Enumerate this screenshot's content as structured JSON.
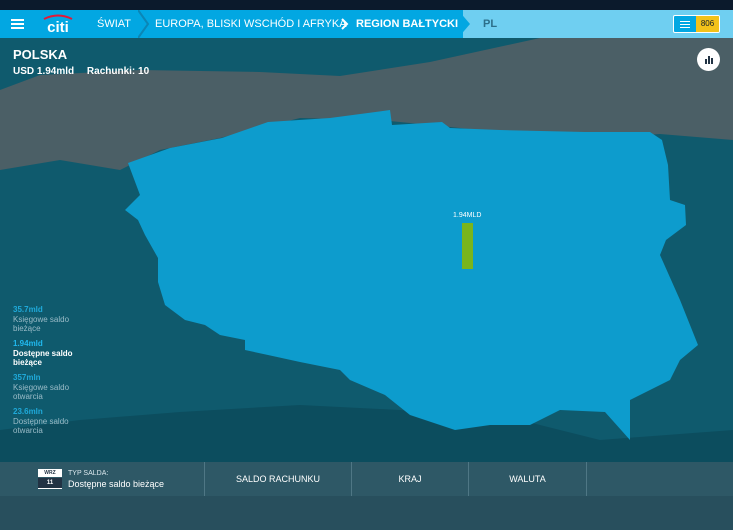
{
  "nav": {
    "menu_icon": "hamburger-icon",
    "logo_text": "citi",
    "breadcrumbs": [
      "ŚWIAT",
      "EUROPA, BLISKI WSCHÓD I AFRYKA",
      "REGION BAŁTYCKI",
      "PL"
    ],
    "badge_count": "806"
  },
  "country": {
    "name": "POLSKA",
    "usd": "USD 1.94mld",
    "accounts": "Rachunki: 10"
  },
  "map": {
    "bar_label": "1.94MLD",
    "bar_color": "#7ab51d",
    "country_color": "#0d9ccd",
    "neighbor_color": "#4b5f66",
    "water_color": "#0f5a6d"
  },
  "legend": [
    {
      "value": "35.7mld",
      "label1": "Księgowe saldo",
      "label2": "bieżące",
      "active": false
    },
    {
      "value": "1.94mld",
      "label1": "Dostępne saldo",
      "label2": "bieżące",
      "active": true
    },
    {
      "value": "357mln",
      "label1": "Księgowe saldo",
      "label2": "otwarcia",
      "active": false
    },
    {
      "value": "23.6mln",
      "label1": "Dostępne saldo",
      "label2": "otwarcia",
      "active": false
    }
  ],
  "bottom": {
    "cal_month": "WRZ",
    "cal_day": "11",
    "type_label": "TYP SALDA:",
    "type_value": "Dostępne saldo bieżące",
    "tabs": [
      "SALDO RACHUNKU",
      "KRAJ",
      "WALUTA"
    ]
  }
}
